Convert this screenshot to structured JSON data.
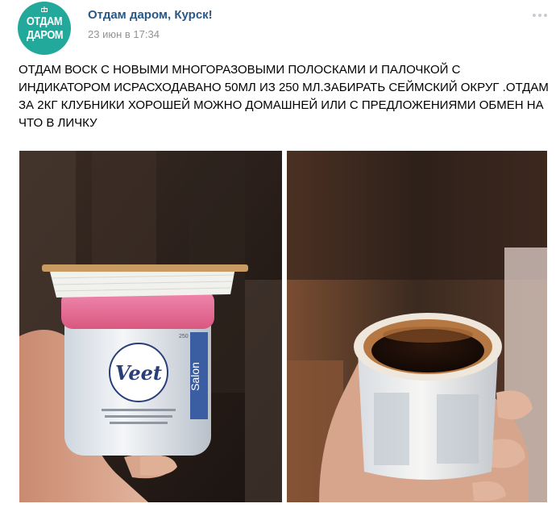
{
  "header": {
    "avatar_line1": "ОТДАМ",
    "avatar_line2": "ДАРОМ",
    "group_name": "Отдам даром, Курск!",
    "date": "23 июн в 17:34",
    "more_icon": "more-dots-icon"
  },
  "post": {
    "text": "ОТДАМ ВОСК С НОВЫМИ МНОГОРАЗОВЫМИ ПОЛОСКАМИ И ПАЛОЧКОЙ С ИНДИКАТОРОМ ИСРАСХОДАВАНО 50МЛ ИЗ 250 МЛ.ЗАБИРАТЬ СЕЙМСКИЙ ОКРУГ .ОТДАМ ЗА 2КГ КЛУБНИКИ ХОРОШЕЙ МОЖНО ДОМАШНЕЙ ИЛИ С ПРЕДЛОЖЕНИЯМИ ОБМЕН НА ЧТО В ЛИЧКУ"
  },
  "photos": {
    "photo1": {
      "brand": "Veet",
      "vertical_label": "Salon",
      "volume": "250"
    }
  },
  "colors": {
    "accent": "#2a5885",
    "avatar_bg": "#22a99b",
    "date": "#939393",
    "jar_lid": "#e86b9a"
  }
}
